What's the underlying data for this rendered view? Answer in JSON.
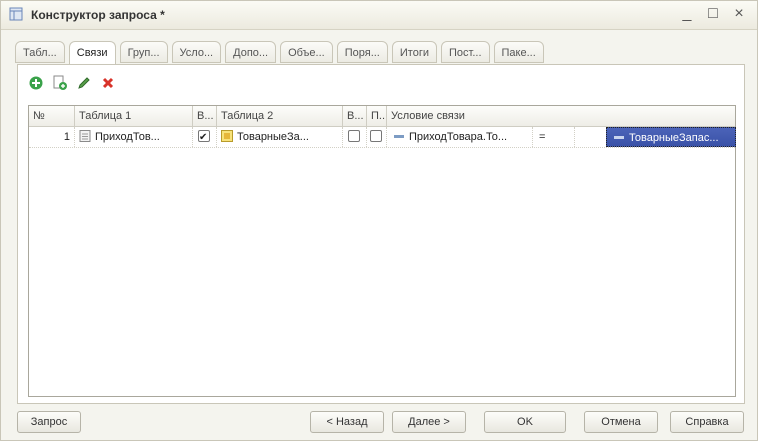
{
  "window": {
    "title": "Конструктор запроса *",
    "minimize": "_",
    "maximize": "□",
    "close": "×"
  },
  "tabs": [
    {
      "label": "Табл..."
    },
    {
      "label": "Связи"
    },
    {
      "label": "Груп..."
    },
    {
      "label": "Усло..."
    },
    {
      "label": "Допо..."
    },
    {
      "label": "Объе..."
    },
    {
      "label": "Поря..."
    },
    {
      "label": "Итоги"
    },
    {
      "label": "Пост..."
    },
    {
      "label": "Паке..."
    }
  ],
  "active_tab": "Связи",
  "toolbar": {
    "icons": [
      "add-icon",
      "copy-icon",
      "edit-icon",
      "delete-icon"
    ]
  },
  "grid": {
    "headers": {
      "num": "№",
      "table1": "Таблица 1",
      "all1": "В...",
      "table2": "Таблица 2",
      "all2": "В...",
      "arbitrary": "П...",
      "condition": "Условие связи"
    },
    "rows": [
      {
        "num": "1",
        "table1": "ПриходТов...",
        "all1_checked": true,
        "table2": "ТоварныеЗа...",
        "all2_checked": false,
        "arbitrary_checked": false,
        "cond_left": "ПриходТовара.То...",
        "cond_op": "=",
        "cond_right": "ТоварныеЗапас..."
      }
    ]
  },
  "buttons": {
    "query": "Запрос",
    "back": "< Назад",
    "next": "Далее >",
    "ok": "OK",
    "cancel": "Отмена",
    "help": "Справка"
  },
  "colors": {
    "selection": "#3f57ad",
    "add_icon": "#3aa24a",
    "delete_icon": "#d8332a"
  }
}
